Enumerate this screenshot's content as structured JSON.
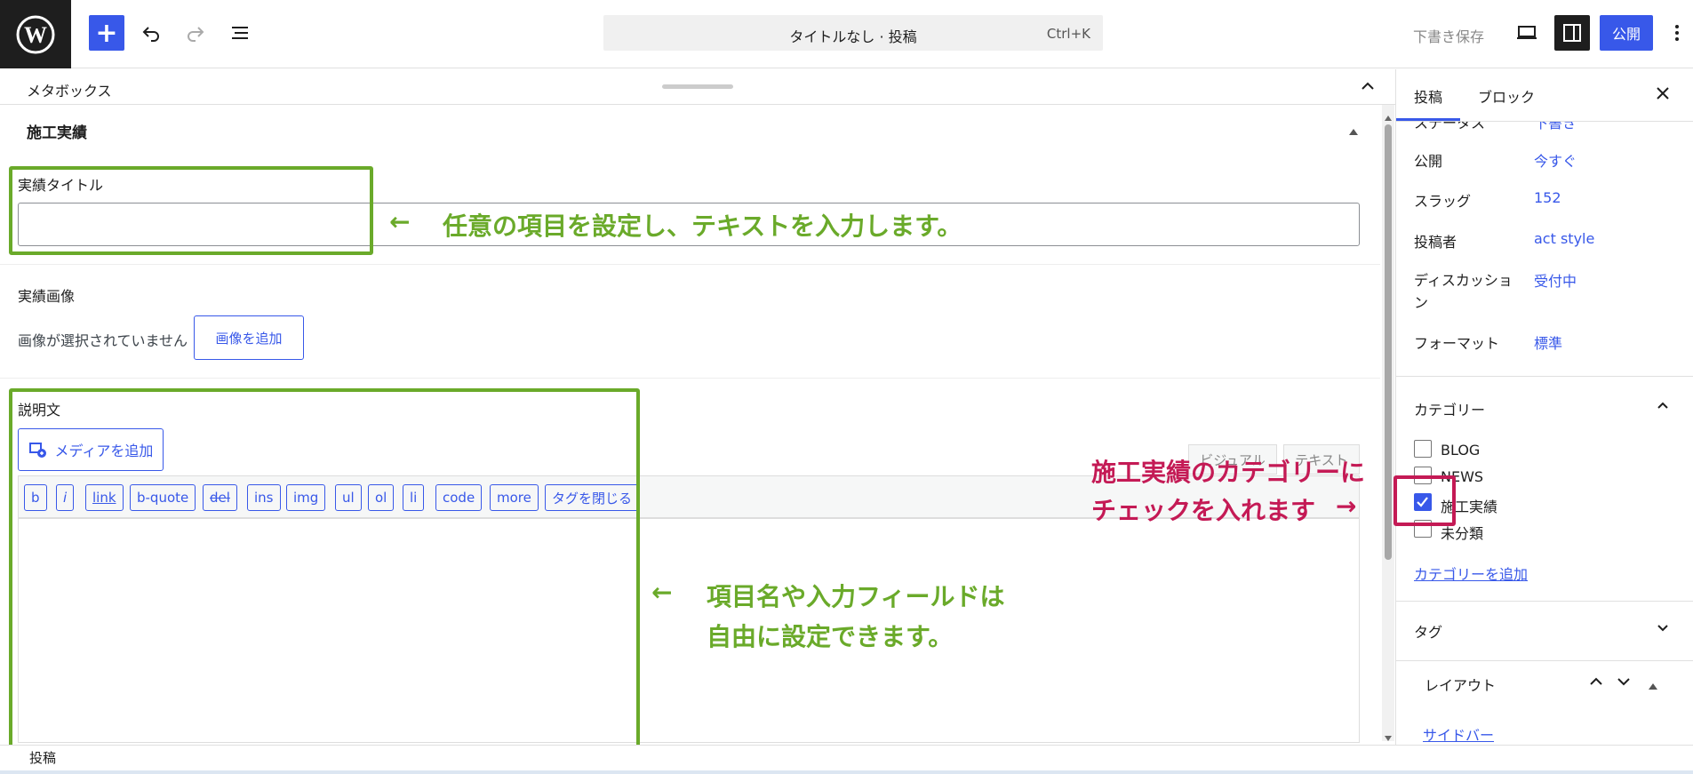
{
  "topbar": {
    "command_title": "タイトルなし · 投稿",
    "command_shortcut": "Ctrl+K",
    "draft_save": "下書き保存",
    "publish": "公開"
  },
  "metabox": {
    "header_title": "メタボックス",
    "section_title": "施工実績",
    "title_field_label": "実績タイトル",
    "title_field_value": "",
    "image_label": "実績画像",
    "image_status": "画像が選択されていません",
    "image_add_button": "画像を追加",
    "description_label": "説明文",
    "add_media_button": "メディアを追加",
    "visual_tab": "ビジュアル",
    "text_tab": "テキスト",
    "quicktags": [
      "b",
      "i",
      "link",
      "b-quote",
      "del",
      "ins",
      "img",
      "ul",
      "ol",
      "li",
      "code",
      "more",
      "タグを閉じる"
    ],
    "footer_label": "投稿"
  },
  "annotations": {
    "arrow_left": "←",
    "title_note": "任意の項目を設定し、テキストを入力します。",
    "field_note_line1": "項目名や入力フィールドは",
    "field_note_line2": "自由に設定できます。",
    "category_note_line1": "施工実績のカテゴリーに",
    "category_note_line2": "チェックを入れます",
    "arrow_right": "→"
  },
  "sidebar": {
    "tab_post": "投稿",
    "tab_block": "ブロック",
    "status_label": "ステータス",
    "status_value": "下書き",
    "rows": [
      {
        "label": "公開",
        "value": "今すぐ"
      },
      {
        "label": "スラッグ",
        "value": "152"
      },
      {
        "label": "投稿者",
        "value": "act style"
      },
      {
        "label": "ディスカッション",
        "value": "受付中"
      },
      {
        "label": "フォーマット",
        "value": "標準"
      }
    ],
    "categories_title": "カテゴリー",
    "categories": [
      {
        "name": "BLOG",
        "checked": false
      },
      {
        "name": "NEWS",
        "checked": false
      },
      {
        "name": "施工実績",
        "checked": true
      },
      {
        "name": "未分類",
        "checked": false
      }
    ],
    "add_category": "カテゴリーを追加",
    "tags_title": "タグ",
    "layout_title": "レイアウト",
    "layout_link": "サイドバー"
  },
  "colors": {
    "accent": "#3858e9",
    "annotation_green": "#6aaa2a",
    "annotation_red": "#c41a55"
  }
}
